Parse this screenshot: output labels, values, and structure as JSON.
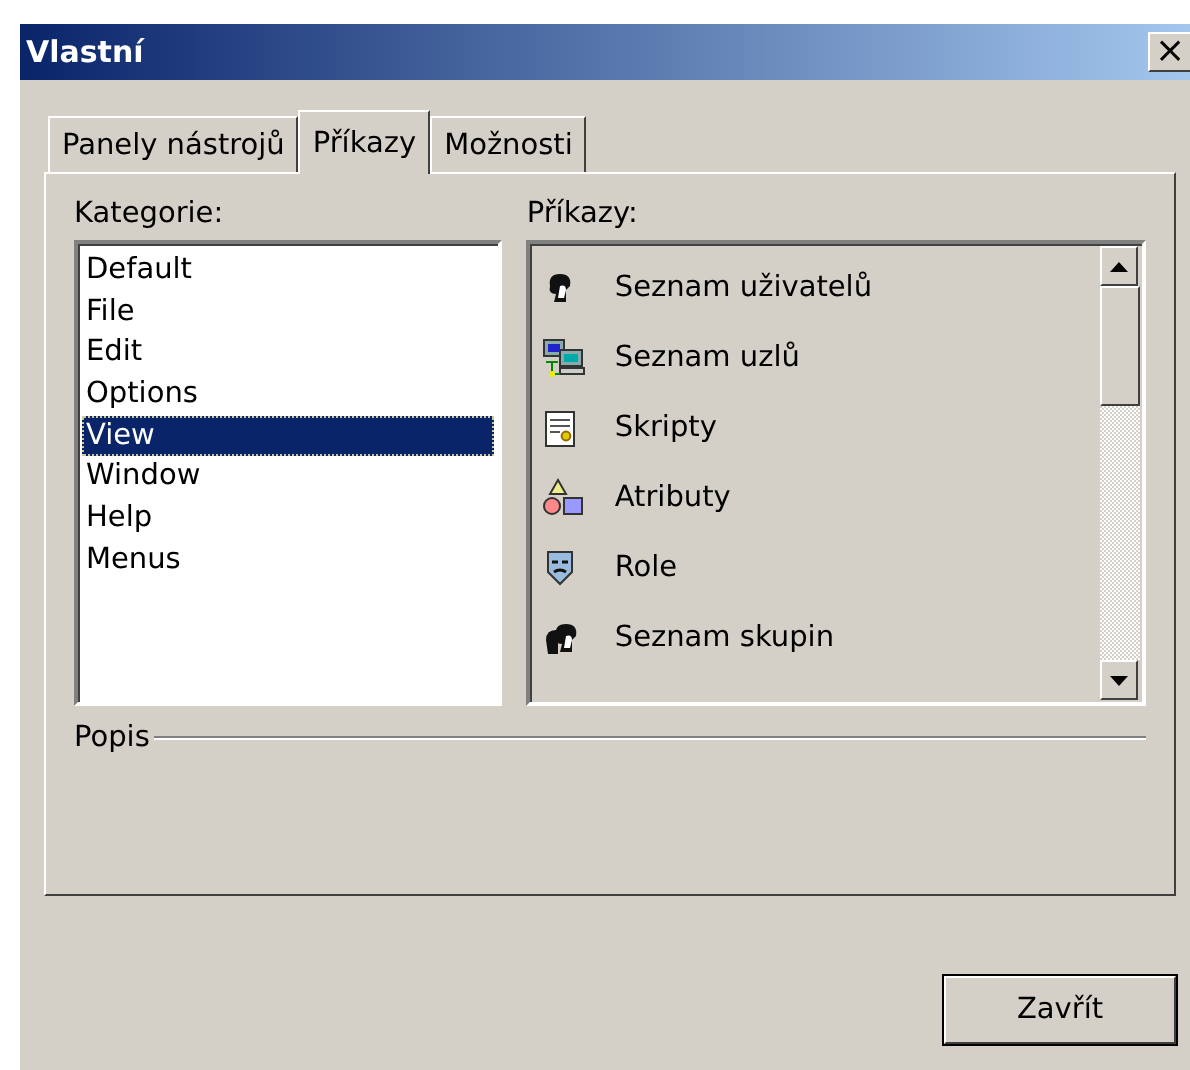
{
  "window": {
    "title": "Vlastní",
    "close": "×"
  },
  "tabs": [
    {
      "label": "Panely nástrojů",
      "selected": false
    },
    {
      "label": "Příkazy",
      "selected": true
    },
    {
      "label": "Možnosti",
      "selected": false
    }
  ],
  "categories": {
    "label": "Kategorie:",
    "items": [
      {
        "label": "Default",
        "selected": false
      },
      {
        "label": "File",
        "selected": false
      },
      {
        "label": "Edit",
        "selected": false
      },
      {
        "label": "Options",
        "selected": false
      },
      {
        "label": "View",
        "selected": true
      },
      {
        "label": "Window",
        "selected": false
      },
      {
        "label": "Help",
        "selected": false
      },
      {
        "label": "Menus",
        "selected": false
      }
    ]
  },
  "commands": {
    "label": "Příkazy:",
    "items": [
      {
        "label": "Seznam uživatelů",
        "kind": "user"
      },
      {
        "label": "Seznam uzlů",
        "kind": "computers"
      },
      {
        "label": "Skripty",
        "kind": "script"
      },
      {
        "label": "Atributy",
        "kind": "shapes"
      },
      {
        "label": "Role",
        "kind": "mask"
      },
      {
        "label": "Seznam skupin",
        "kind": "users"
      }
    ]
  },
  "description": {
    "label": "Popis"
  },
  "buttons": [
    "Zavřít"
  ]
}
